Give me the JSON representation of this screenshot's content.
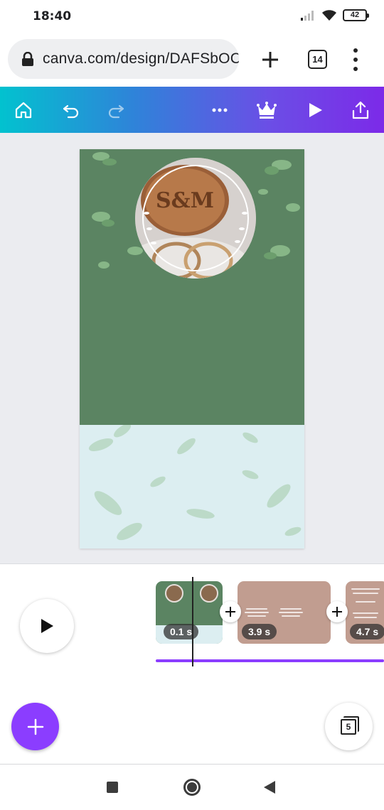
{
  "status_bar": {
    "time": "18:40",
    "battery": "42",
    "icons": [
      "signal-icon",
      "wifi-icon",
      "battery-icon"
    ]
  },
  "browser": {
    "url": "canva.com/design/DAFSbOC(",
    "tab_count": "14",
    "icons": [
      "lock-icon",
      "new-tab-plus-icon",
      "tabs-icon",
      "more-vert-icon"
    ]
  },
  "toolbar": {
    "gradient": [
      "#02c2cf",
      "#7c2ae8"
    ],
    "icons": [
      "home-icon",
      "undo-icon",
      "redo-icon",
      "more-icon",
      "crown-icon",
      "play-icon",
      "share-icon"
    ]
  },
  "canvas": {
    "monogram": "S&M",
    "colors": {
      "green": "#5b8462",
      "mint": "#dceef1"
    }
  },
  "timeline": {
    "clips": [
      {
        "duration": "0.1 s",
        "color": "#5b8462"
      },
      {
        "duration": "3.9 s",
        "color": "#c19d90"
      },
      {
        "duration": "4.7 s",
        "color": "#c19d90"
      }
    ],
    "page_count": "5",
    "accent": "#8b3dff"
  },
  "nav": {
    "icons": [
      "recents-square-icon",
      "home-circle-icon",
      "back-triangle-icon"
    ]
  }
}
